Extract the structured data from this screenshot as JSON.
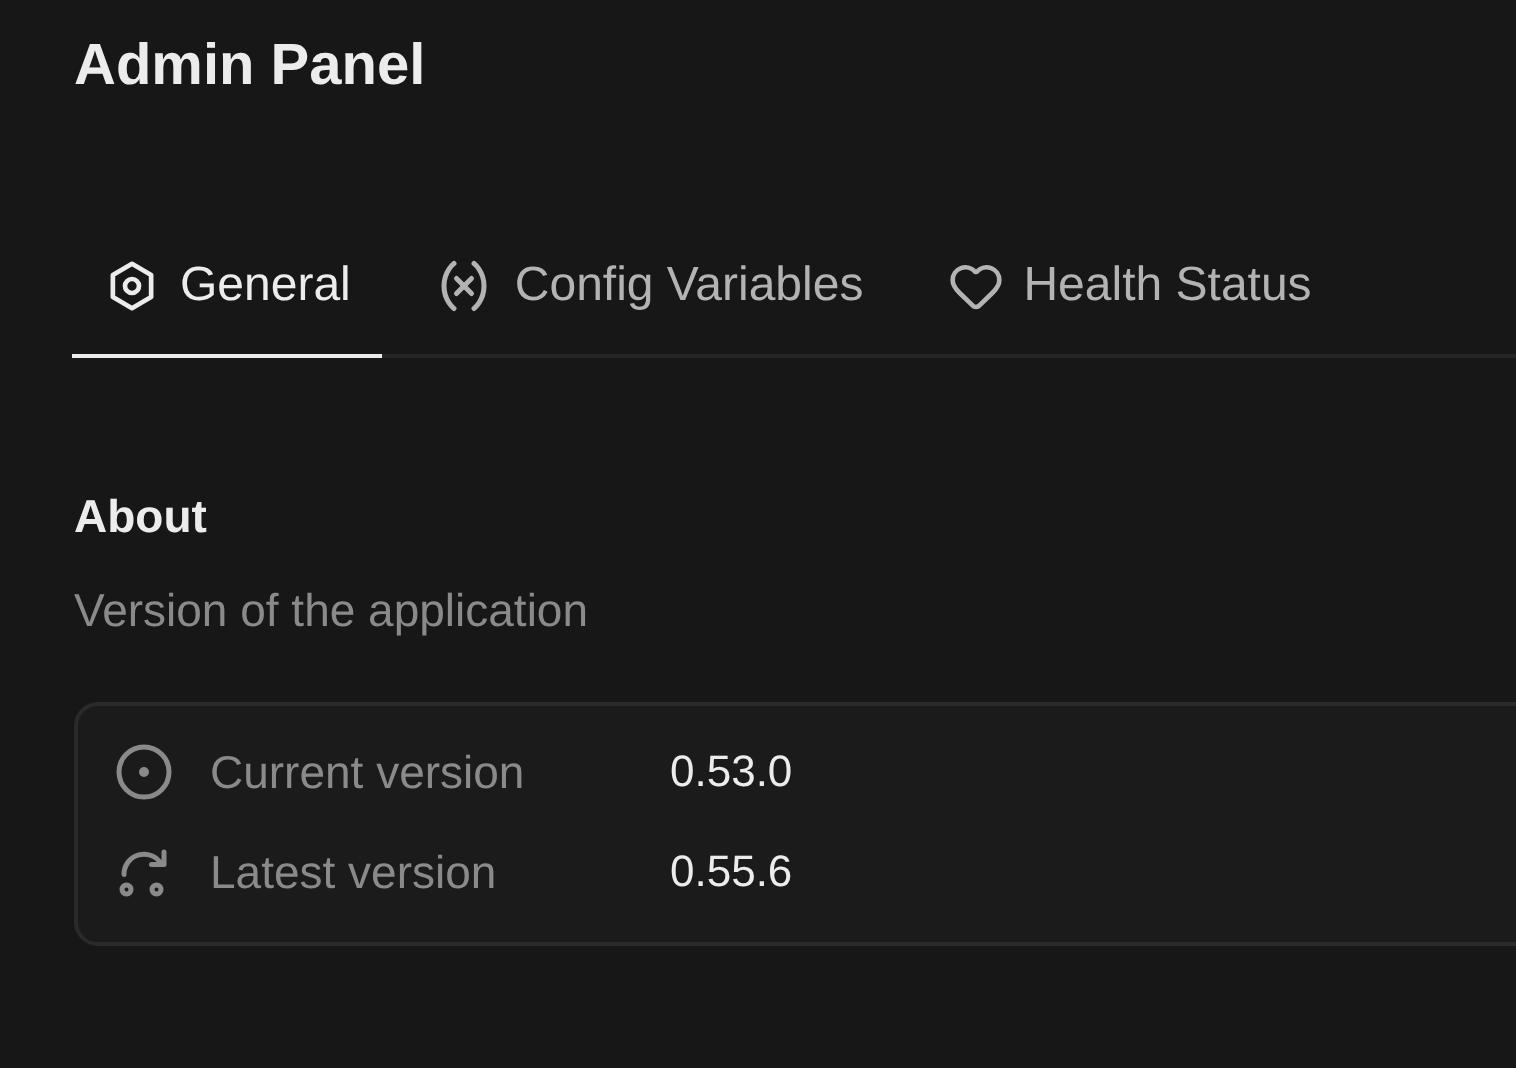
{
  "title": "Admin Panel",
  "tabs": [
    {
      "label": "General",
      "selected": true
    },
    {
      "label": "Config Variables",
      "selected": false
    },
    {
      "label": "Health Status",
      "selected": false
    }
  ],
  "section": {
    "title": "About",
    "description": "Version of the application"
  },
  "versions": [
    {
      "label": "Current version",
      "value": "0.53.0"
    },
    {
      "label": "Latest version",
      "value": "0.55.6"
    }
  ]
}
